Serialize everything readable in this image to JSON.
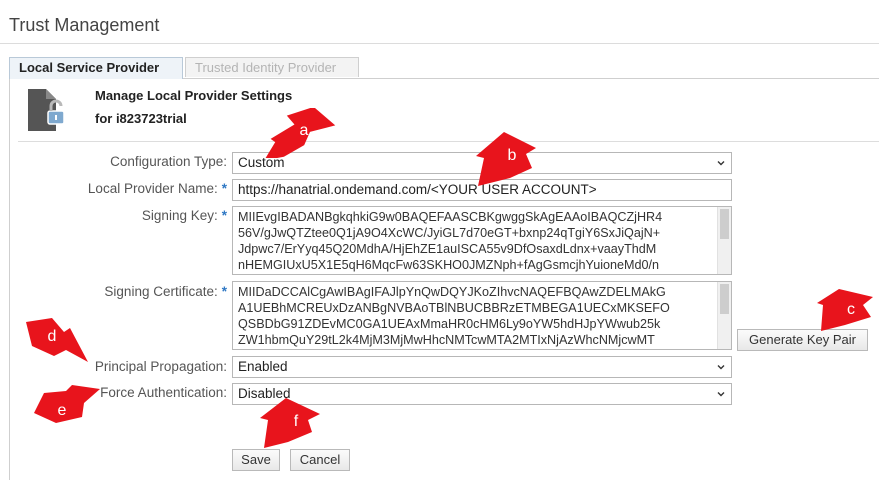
{
  "page": {
    "title": "Trust Management"
  },
  "tabs": [
    {
      "label": "Local Service Provider",
      "active": true
    },
    {
      "label": "Trusted Identity Provider",
      "active": false
    }
  ],
  "header": {
    "title": "Manage Local Provider Settings",
    "subtitle": "for i823723trial",
    "icon": "locked-document-icon"
  },
  "form": {
    "configuration_type": {
      "label": "Configuration Type:",
      "value": "Custom"
    },
    "local_provider_name": {
      "label": "Local Provider Name:",
      "required_mark": "*",
      "value": "https://hanatrial.ondemand.com/<YOUR USER ACCOUNT>"
    },
    "signing_key": {
      "label": "Signing Key:",
      "required_mark": "*",
      "lines": [
        "MIIEvgIBADANBgkqhkiG9w0BAQEFAASCBKgwggSkAgEAAoIBAQCZjHR4",
        "56V/gJwQTZtee0Q1jA9O4XcWC/JyiGL7d70eGT+bxnp24qTgiY6SxJiQajN+",
        "Jdpwc7/ErYyq45Q20MdhA/HjEhZE1auISCA55v9DfOsaxdLdnx+vaayThdM",
        "nHEMGIUxU5X1E5qH6MqcFw63SKHO0JMZNph+fAgGsmcjhYuioneMd0/n"
      ]
    },
    "signing_certificate": {
      "label": "Signing Certificate:",
      "required_mark": "*",
      "lines": [
        "MIIDaDCCAlCgAwIBAgIFAJlpYnQwDQYJKoZIhvcNAQEFBQAwZDELMAkG",
        "A1UEBhMCREUxDzANBgNVBAoTBlNBUCBBRzETMBEGA1UECxMKSEFO",
        "QSBDbG91ZDEvMC0GA1UEAxMmaHR0cHM6Ly9oYW5hdHJpYWwub25k",
        "ZW1hbmQuY29tL2k4MjM3MjMwHhcNMTcwMTA2MTIxNjAzWhcNMjcwMT"
      ]
    },
    "generate_key_pair_label": "Generate Key Pair",
    "principal_propagation": {
      "label": "Principal Propagation:",
      "value": "Enabled"
    },
    "force_authentication": {
      "label": "Force Authentication:",
      "value": "Disabled"
    },
    "save_label": "Save",
    "cancel_label": "Cancel"
  },
  "annotations": {
    "color": "#e8141c",
    "markers": [
      "a",
      "b",
      "c",
      "d",
      "e",
      "f"
    ]
  }
}
